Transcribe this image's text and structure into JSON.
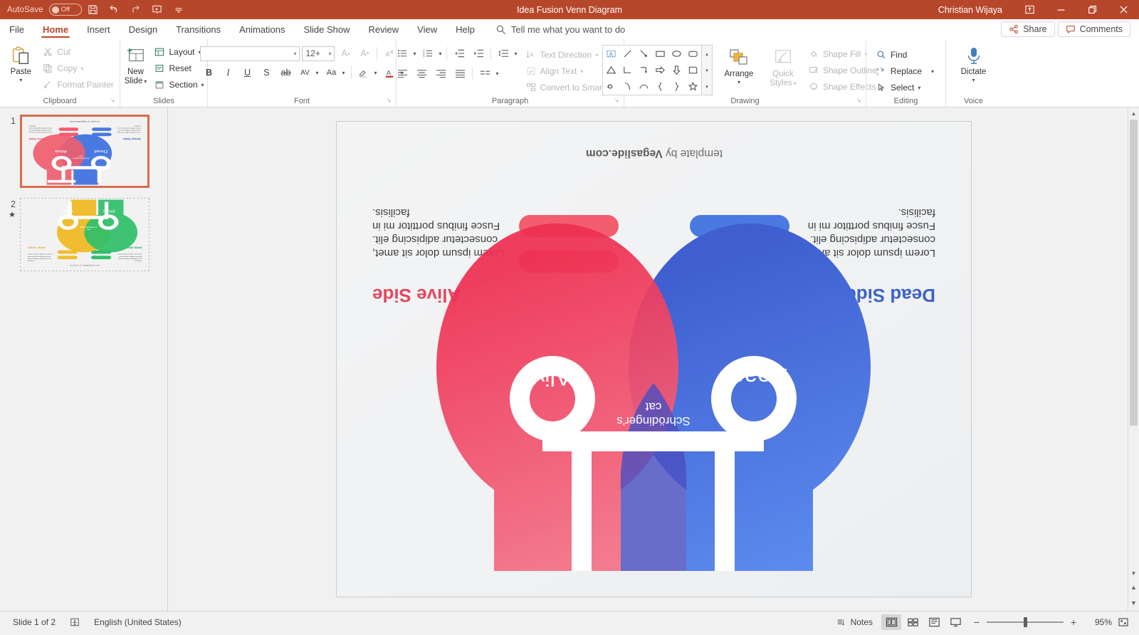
{
  "titlebar": {
    "autosave_label": "AutoSave",
    "autosave_state": "Off",
    "document_title": "Idea Fusion Venn Diagram",
    "user_name": "Christian Wijaya",
    "accent_color": "#b7472a",
    "qat": [
      {
        "name": "save-icon",
        "label": "Save"
      },
      {
        "name": "undo-icon",
        "label": "Undo"
      },
      {
        "name": "redo-icon",
        "label": "Redo"
      },
      {
        "name": "start-presentation-icon",
        "label": "Start From Beginning"
      },
      {
        "name": "customize-qat-icon",
        "label": "Customize Quick Access Toolbar"
      }
    ],
    "window_controls": [
      {
        "name": "ribbon-display-options-icon",
        "label": "Ribbon Display Options"
      },
      {
        "name": "minimize-icon",
        "label": "Minimize"
      },
      {
        "name": "restore-icon",
        "label": "Restore Down"
      },
      {
        "name": "close-icon",
        "label": "Close"
      }
    ]
  },
  "tabs": [
    {
      "label": "File",
      "active": false
    },
    {
      "label": "Home",
      "active": true
    },
    {
      "label": "Insert",
      "active": false
    },
    {
      "label": "Design",
      "active": false
    },
    {
      "label": "Transitions",
      "active": false
    },
    {
      "label": "Animations",
      "active": false
    },
    {
      "label": "Slide Show",
      "active": false
    },
    {
      "label": "Review",
      "active": false
    },
    {
      "label": "View",
      "active": false
    },
    {
      "label": "Help",
      "active": false
    }
  ],
  "tellme": {
    "placeholder": "Tell me what you want to do"
  },
  "share": {
    "label": "Share"
  },
  "comments": {
    "label": "Comments"
  },
  "ribbon": {
    "clipboard": {
      "group_label": "Clipboard",
      "paste": "Paste",
      "cut": "Cut",
      "copy": "Copy",
      "format_painter": "Format Painter"
    },
    "slides": {
      "group_label": "Slides",
      "new_slide_line1": "New",
      "new_slide_line2": "Slide",
      "layout": "Layout",
      "reset": "Reset",
      "section": "Section"
    },
    "font": {
      "group_label": "Font",
      "font_name": "",
      "font_size": "12+",
      "buttons": [
        "B",
        "I",
        "U",
        "S",
        "ab",
        "AV",
        "Aa"
      ]
    },
    "paragraph": {
      "group_label": "Paragraph",
      "text_direction": "Text Direction",
      "align_text": "Align Text",
      "convert_smartart": "Convert to SmartArt"
    },
    "drawing": {
      "group_label": "Drawing",
      "arrange": "Arrange",
      "quick_styles_line1": "Quick",
      "quick_styles_line2": "Styles",
      "shape_fill": "Shape Fill",
      "shape_outline": "Shape Outline",
      "shape_effects": "Shape Effects"
    },
    "editing": {
      "group_label": "Editing",
      "find": "Find",
      "replace": "Replace",
      "select": "Select"
    },
    "voice": {
      "group_label": "Voice",
      "dictate": "Dictate"
    }
  },
  "thumbnails": [
    {
      "number": "1",
      "selected": true,
      "starred": false
    },
    {
      "number": "2",
      "selected": false,
      "starred": true
    }
  ],
  "slide": {
    "rotated_180": true,
    "footer": "template by Vegaslide.com",
    "left": {
      "heading": "Dead Side",
      "body": "Lorem ipsum dolor sit amet, consectetur adipiscing elit. Fusce finibus porttitor mi in facilisis.",
      "color": "#3e63c8",
      "bulb_label": "Dead"
    },
    "right": {
      "heading": "Alive Side",
      "body": "Lorem ipsum dolor sit amet, consectetur adipiscing elit. Fusce finibus porttitor mi in facilisis.",
      "color": "#e34860",
      "bulb_label": "Alive"
    },
    "overlap": {
      "label_line1": "Schrödinger's",
      "label_line2": "cat",
      "color": "#4a4fc0"
    }
  },
  "statusbar": {
    "slide_counter": "Slide 1 of 2",
    "accessibility_label": "",
    "language": "English (United States)",
    "notes": "Notes",
    "views": [
      {
        "name": "normal-view-icon",
        "label": "Normal",
        "active": true
      },
      {
        "name": "slide-sorter-view-icon",
        "label": "Slide Sorter",
        "active": false
      },
      {
        "name": "reading-view-icon",
        "label": "Reading View",
        "active": false
      },
      {
        "name": "slide-show-icon",
        "label": "Slide Show",
        "active": false
      }
    ],
    "zoom_out": "−",
    "zoom_in": "+",
    "zoom_percent": "95%"
  }
}
